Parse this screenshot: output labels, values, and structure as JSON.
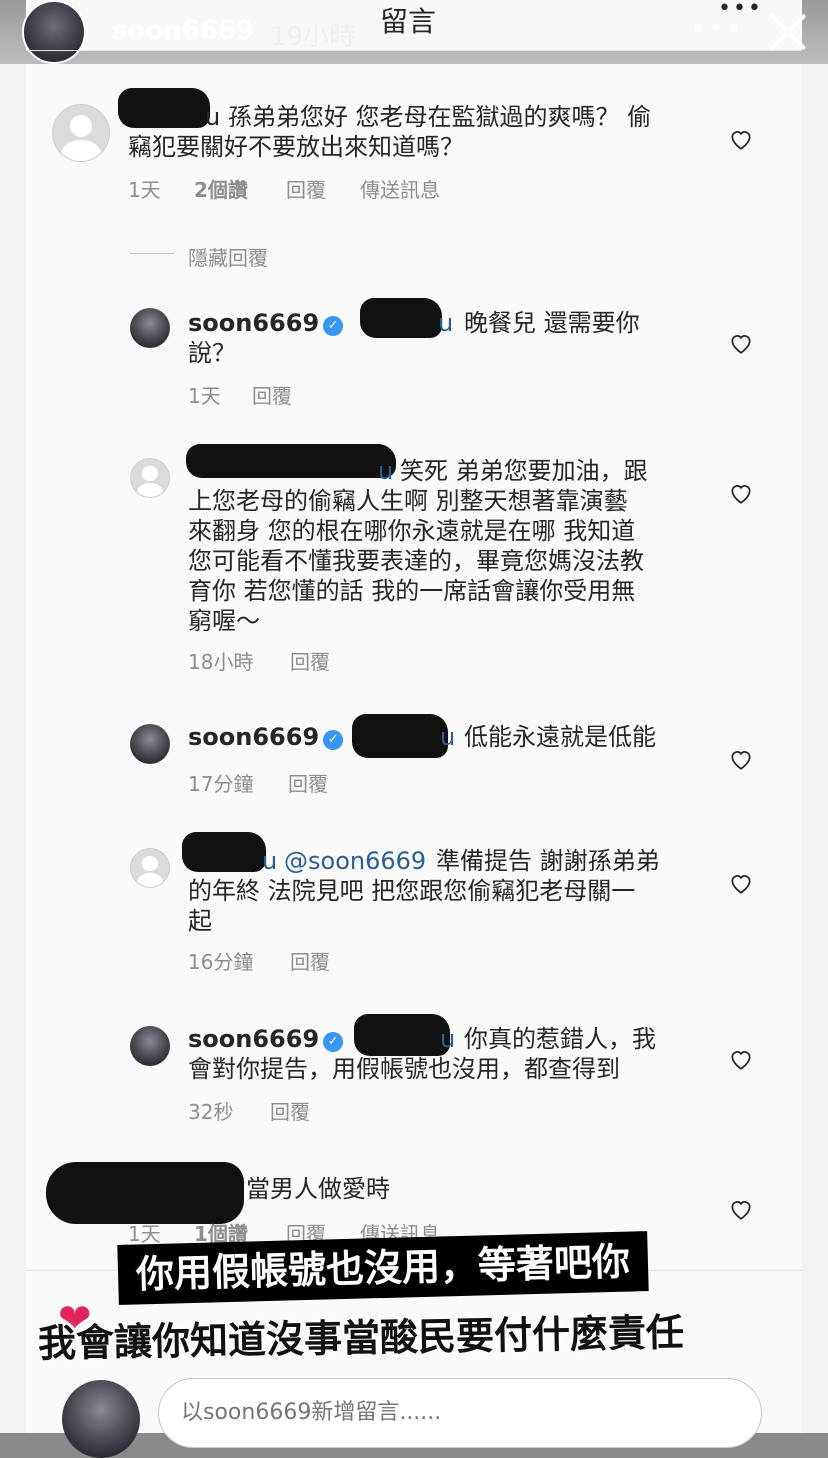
{
  "story": {
    "username": "soon6669",
    "time": "19小時"
  },
  "panel_title": "留言",
  "comments": [
    {
      "text": "u 孫弟弟您好 您老母在監獄過的爽嗎？ 偷竊犯要關好不要放出來知道嗎？",
      "line1": "u 孫弟弟您好 您老母在監獄過的爽嗎？ 偷",
      "line2": "竊犯要關好不要放出來知道嗎？",
      "time": "1天",
      "likes": "2個讚",
      "reply": "回覆",
      "send": "傳送訊息"
    },
    {
      "hide_replies": "隱藏回覆"
    },
    {
      "username": "soon6669",
      "mention_tail": "u",
      "line1": "晚餐兒 還需要你",
      "line2": "說？",
      "time": "1天",
      "reply": "回覆"
    },
    {
      "mention_tail": "u",
      "line1": "笑死 弟弟您要加油，跟",
      "line2": "上您老母的偷竊人生啊 別整天想著靠演藝",
      "line3": "來翻身 您的根在哪你永遠就是在哪 我知道",
      "line4": "您可能看不懂我要表達的，畢竟您媽沒法教",
      "line5": "育你 若您懂的話 我的一席話會讓你受用無",
      "line6": "窮喔～",
      "time": "18小時",
      "reply": "回覆"
    },
    {
      "username": "soon6669",
      "mention_tail": "u",
      "line1": "低能永遠就是低能",
      "time": "17分鐘",
      "reply": "回覆"
    },
    {
      "mention_tail": "u",
      "mention": "@soon6669",
      "line1": "準備提告 謝謝孫弟弟",
      "line2": "的年終 法院見吧 把您跟您偷竊犯老母關一",
      "line3": "起",
      "time": "16分鐘",
      "reply": "回覆"
    },
    {
      "username": "soon6669",
      "mention_tail": "u",
      "line1": "你真的惹錯人，我",
      "line2": "會對你提告，用假帳號也沒用，都查得到",
      "time": "32秒",
      "reply": "回覆"
    },
    {
      "line1": "當男人做愛時",
      "time": "1天",
      "likes": "1個讚",
      "reply": "回覆",
      "send": "傳送訊息"
    }
  ],
  "caption_line1": "你用假帳號也沒用，等著吧你",
  "caption_line2": "我會讓你知道沒事當酸民要付什麼責任",
  "input": {
    "placeholder": "以soon6669新增留言......"
  },
  "icons": {
    "heart": "heart-outline-icon",
    "close": "close-icon",
    "more": "more-dots-icon",
    "verified": "verified-badge-icon"
  }
}
